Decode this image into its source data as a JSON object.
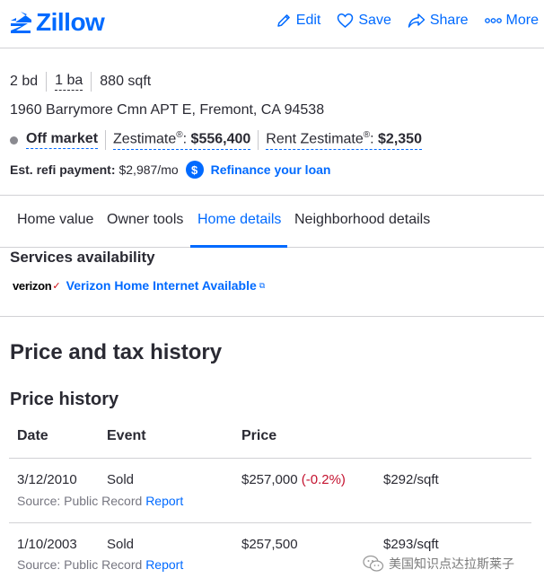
{
  "header": {
    "logo_text": "Zillow",
    "actions": {
      "edit": "Edit",
      "save": "Save",
      "share": "Share",
      "more": "More"
    }
  },
  "summary": {
    "beds": "2 bd",
    "baths": "1 ba",
    "sqft": "880 sqft",
    "address": "1960 Barrymore Cmn APT E, Fremont, CA 94538",
    "status": "Off market",
    "zestimate_label": "Zestimate",
    "zestimate_value": "$556,400",
    "rent_zestimate_label": "Rent Zestimate",
    "rent_zestimate_value": "$2,350",
    "refi_label": "Est. refi payment:",
    "refi_value": "$2,987/mo",
    "refi_link": "Refinance your loan"
  },
  "tabs": [
    "Home value",
    "Owner tools",
    "Home details",
    "Neighborhood details"
  ],
  "active_tab": "Home details",
  "services": {
    "title": "Services availability",
    "brand": "verizon",
    "link": "Verizon Home Internet Available"
  },
  "price_tax_title": "Price and tax history",
  "price_history": {
    "title": "Price history",
    "columns": [
      "Date",
      "Event",
      "Price"
    ],
    "rows": [
      {
        "date": "3/12/2010",
        "event": "Sold",
        "price": "$257,000",
        "change": "(-0.2%)",
        "per_sqft": "$292/sqft",
        "source": "Source: Public Record",
        "report": "Report"
      },
      {
        "date": "1/10/2003",
        "event": "Sold",
        "price": "$257,500",
        "change": "",
        "per_sqft": "$293/sqft",
        "source": "Source: Public Record",
        "report": "Report"
      }
    ]
  },
  "watermark": "美国知识点达拉斯莱子",
  "colors": {
    "brand": "#006aff",
    "text": "#2a2a33",
    "negative": "#c4122f",
    "muted": "#767680"
  }
}
